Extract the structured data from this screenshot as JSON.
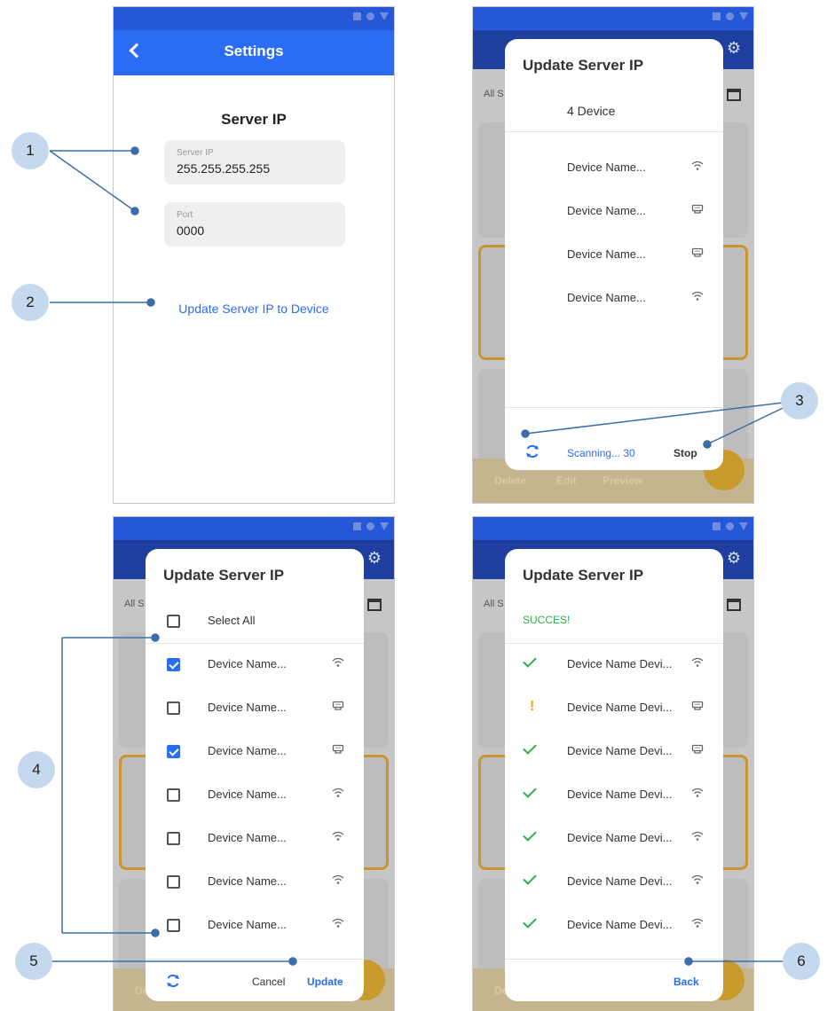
{
  "callouts": [
    "1",
    "2",
    "3",
    "4",
    "5",
    "6"
  ],
  "colors": {
    "primary": "#2a6df4",
    "success": "#2fae4c",
    "warning": "#f2a20c",
    "annotation": "#3b6ea8"
  },
  "screen1": {
    "title": "Settings",
    "section_title": "Server IP",
    "server_ip": {
      "label": "Server IP",
      "value": "255.255.255.255"
    },
    "port": {
      "label": "Port",
      "value": "0000"
    },
    "update_link": "Update Server IP to Device"
  },
  "background_app": {
    "filter_label": "All S",
    "actions": {
      "delete": "Delete",
      "edit": "Edit",
      "preview": "Preview"
    }
  },
  "screen2": {
    "dialog_title": "Update Server IP",
    "device_count": "4 Device",
    "devices": [
      {
        "name": "Device Name...",
        "icon": "wifi-icon"
      },
      {
        "name": "Device Name...",
        "icon": "ethernet-icon"
      },
      {
        "name": "Device Name...",
        "icon": "ethernet-icon"
      },
      {
        "name": "Device Name...",
        "icon": "wifi-icon"
      }
    ],
    "scanning_text": "Scanning... 30",
    "stop_label": "Stop"
  },
  "screen3": {
    "dialog_title": "Update Server IP",
    "select_all_label": "Select All",
    "devices": [
      {
        "name": "Device Name...",
        "checked": true,
        "icon": "wifi-icon"
      },
      {
        "name": "Device Name...",
        "checked": false,
        "icon": "ethernet-icon"
      },
      {
        "name": "Device Name...",
        "checked": true,
        "icon": "ethernet-icon"
      },
      {
        "name": "Device Name...",
        "checked": false,
        "icon": "wifi-icon"
      },
      {
        "name": "Device Name...",
        "checked": false,
        "icon": "wifi-icon"
      },
      {
        "name": "Device Name...",
        "checked": false,
        "icon": "wifi-icon"
      },
      {
        "name": "Device Name...",
        "checked": false,
        "icon": "wifi-icon"
      }
    ],
    "cancel_label": "Cancel",
    "update_label": "Update"
  },
  "screen4": {
    "dialog_title": "Update Server IP",
    "status_text": "SUCCES!",
    "devices": [
      {
        "name": "Device Name Devi...",
        "status": "success",
        "icon": "wifi-icon"
      },
      {
        "name": "Device Name Devi...",
        "status": "warning",
        "icon": "ethernet-icon"
      },
      {
        "name": "Device Name Devi...",
        "status": "success",
        "icon": "ethernet-icon"
      },
      {
        "name": "Device Name Devi...",
        "status": "success",
        "icon": "wifi-icon"
      },
      {
        "name": "Device Name Devi...",
        "status": "success",
        "icon": "wifi-icon"
      },
      {
        "name": "Device Name Devi...",
        "status": "success",
        "icon": "wifi-icon"
      },
      {
        "name": "Device Name Devi...",
        "status": "success",
        "icon": "wifi-icon"
      }
    ],
    "back_label": "Back"
  }
}
